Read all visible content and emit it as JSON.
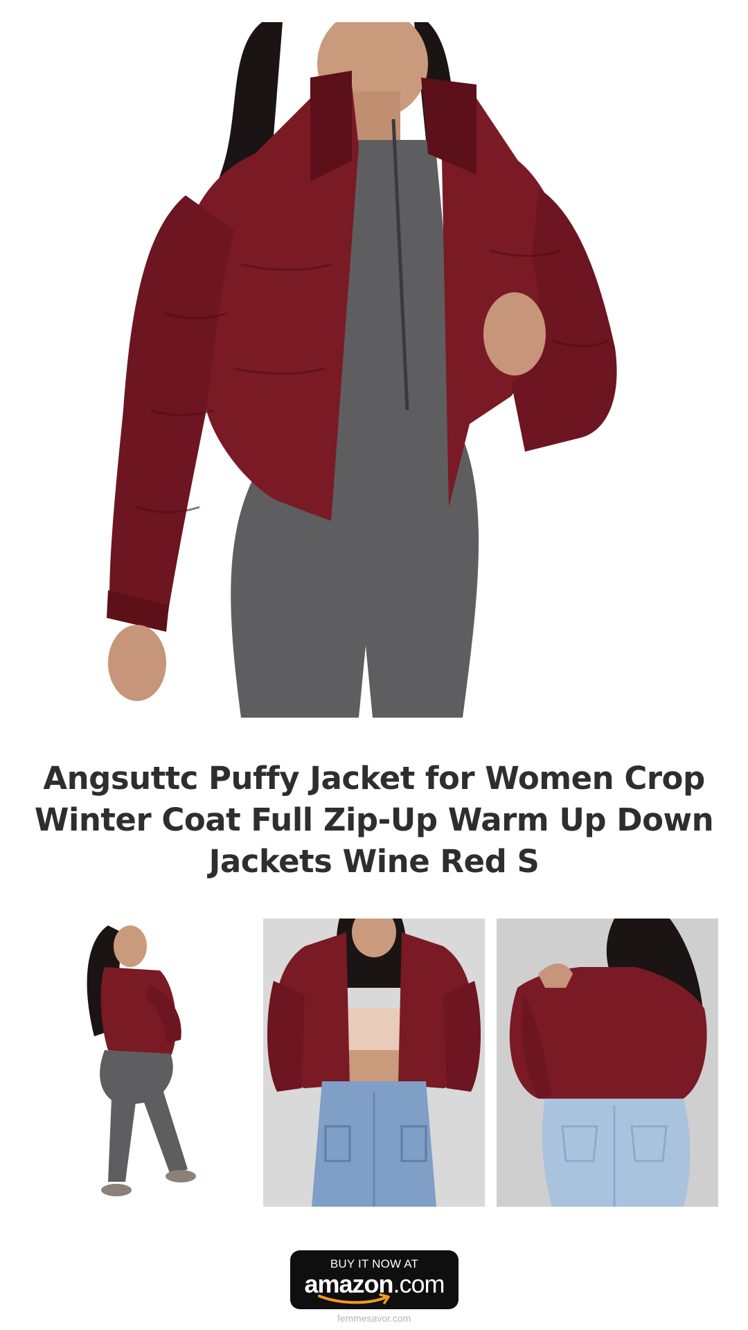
{
  "product": {
    "title": "Angsuttc Puffy Jacket for Women Crop Winter Coat Full Zip-Up Warm Up Down Jackets Wine Red S"
  },
  "cta": {
    "top_label": "BUY IT NOW AT",
    "brand": "amazon",
    "tld": ".com"
  },
  "footer": {
    "site": "femmesavor.com"
  },
  "colors": {
    "jacket": "#7a1a24",
    "bodysuit": "#5e5e60",
    "denim": "#7f9fc6",
    "button": "#0f0f0f",
    "smile": "#f29a1f",
    "title": "#2e2e2e"
  }
}
